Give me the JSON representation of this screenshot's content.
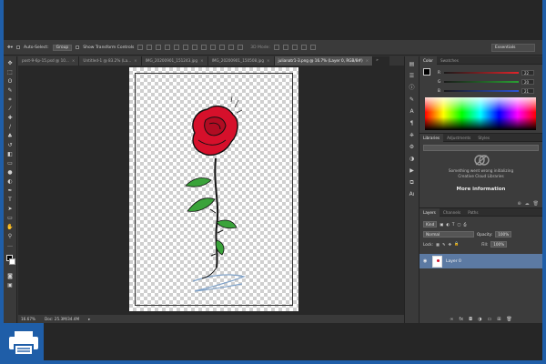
{
  "options_bar": {
    "auto_select_label": "Auto-Select:",
    "auto_select_value": "Group",
    "show_transform_label": "Show Transform Controls",
    "mode_3d_label": "3D Mode:",
    "workspace": "Essentials"
  },
  "tabs": [
    {
      "label": "post-9-6p-15.psd @ 10...",
      "active": false
    },
    {
      "label": "Untitled-1 @ 83.2% (La...",
      "active": false
    },
    {
      "label": "IMG_20200901_151243.jpg",
      "active": false
    },
    {
      "label": "IMG_20200901_150508.jpg",
      "active": false
    },
    {
      "label": "julianatr1-3.png @ 16.7% (Layer 0, RGB/8#)",
      "active": true
    }
  ],
  "tabs_more": "»",
  "status": {
    "zoom": "16.67%",
    "doc": "Doc: 25.3M/34.4M",
    "arrow": "▸"
  },
  "color_panel": {
    "tab_color": "Color",
    "tab_swatches": "Swatches",
    "r_label": "R",
    "g_label": "G",
    "b_label": "B",
    "r_value": "22",
    "g_value": "20",
    "b_value": "21",
    "r_bar_color": "#e0242a",
    "g_bar_color": "#2aa033",
    "b_bar_color": "#2c54d6"
  },
  "libraries_panel": {
    "tab_libraries": "Libraries",
    "tab_adjustments": "Adjustments",
    "tab_styles": "Styles",
    "message_line1": "Something went wrong initializing",
    "message_line2": "Creative Cloud Libraries",
    "link": "More information"
  },
  "layers_panel": {
    "tab_layers": "Layers",
    "tab_channels": "Channels",
    "tab_paths": "Paths",
    "filter_kind": "Kind",
    "blend_mode": "Normal",
    "opacity_label": "Opacity:",
    "opacity_value": "100%",
    "lock_label": "Lock:",
    "fill_label": "Fill:",
    "fill_value": "100%",
    "layers": [
      {
        "name": "Layer 0",
        "visible": true,
        "selected": true
      }
    ]
  },
  "colors": {
    "accent_blue": "#1f5ea8",
    "selection_blue": "#5c7aa3",
    "rose_red": "#d6102b"
  }
}
